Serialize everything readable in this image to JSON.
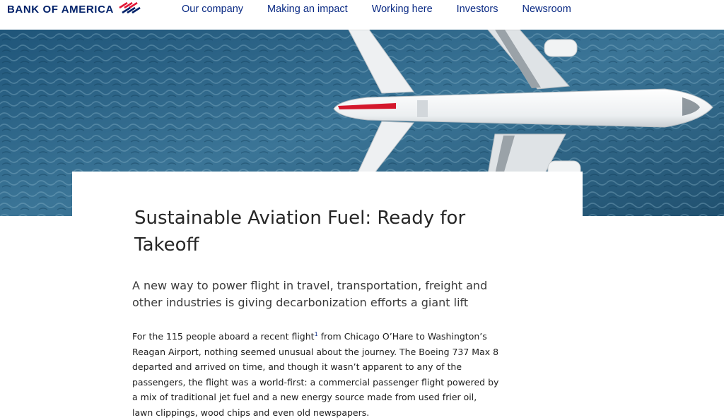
{
  "brand": {
    "name": "BANK OF AMERICA",
    "logo_icon": "flag-logo-icon",
    "color": "#012169",
    "accent": "#e31837"
  },
  "nav": {
    "items": [
      {
        "label": "Our company"
      },
      {
        "label": "Making an impact"
      },
      {
        "label": "Working here"
      },
      {
        "label": "Investors"
      },
      {
        "label": "Newsroom"
      }
    ]
  },
  "hero": {
    "image": "airplane-over-ocean-photo"
  },
  "article": {
    "title": "Sustainable Aviation Fuel: Ready for Takeoff",
    "subtitle": "A new way to power flight in travel, transportation, freight and other industries is giving decarbonization efforts a giant lift",
    "body_start": "For the 115 people aboard a recent flight",
    "footnote": "1",
    "body_rest": " from Chicago O’Hare to Washington’s Reagan Airport, nothing seemed unusual about the journey. The Boeing 737 Max 8 departed and arrived on time, and though it wasn’t apparent to any of the passengers, the flight was a world-first: a commercial passenger flight powered by a mix of traditional jet fuel and a new energy source made from used frier oil, lawn clippings, wood chips and even old newspapers."
  }
}
